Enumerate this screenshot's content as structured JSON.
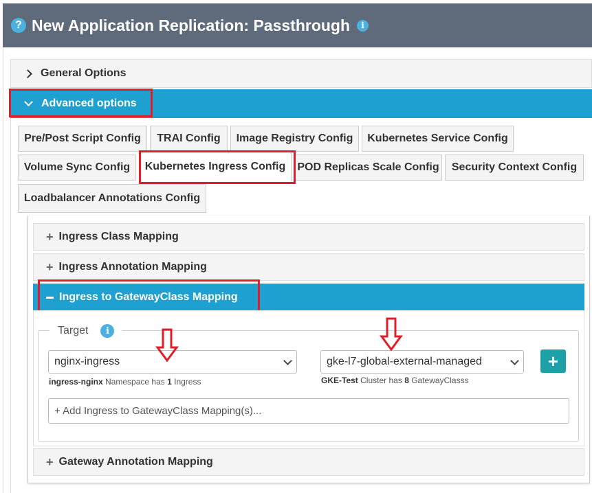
{
  "header": {
    "title": "New Application Replication: Passthrough",
    "help_glyph": "?",
    "info_glyph": "i"
  },
  "accordions": {
    "general": "General Options",
    "advanced": "Advanced options"
  },
  "tabs": [
    "Pre/Post Script Config",
    "TRAI Config",
    "Image Registry Config",
    "Kubernetes Service Config",
    "Volume Sync Config",
    "Kubernetes Ingress Config",
    "POD Replicas Scale Config",
    "Security Context Config",
    "Loadbalancer Annotations Config"
  ],
  "active_tab": "Kubernetes Ingress Config",
  "sub_accordions": {
    "ingress_class": "Ingress Class Mapping",
    "ingress_annotation": "Ingress Annotation Mapping",
    "ingress_gateway": "Ingress to GatewayClass Mapping",
    "gateway_annotation": "Gateway Annotation Mapping"
  },
  "target": {
    "legend": "Target",
    "info_glyph": "i",
    "ingress_select": "nginx-ingress",
    "ingress_hint_name": "ingress-nginx",
    "ingress_hint_text": "Namespace has",
    "ingress_hint_count": "1",
    "ingress_hint_unit": "Ingress",
    "gateway_select": "gke-l7-global-external-managed",
    "gateway_hint_name": "GKE-Test",
    "gateway_hint_text": "Cluster has",
    "gateway_hint_count": "8",
    "gateway_hint_unit": "GatewayClasss",
    "add_button": "+",
    "add_placeholder": "+ Add Ingress to GatewayClass Mapping(s)..."
  },
  "colors": {
    "header_bg": "#5f6b7a",
    "accent": "#1ea0d0",
    "highlight": "#e01e2a",
    "add_button": "#1ea0a8"
  },
  "icons": {
    "help": "question-circle-icon",
    "info": "info-circle-icon",
    "expand": "chevron-right-icon",
    "collapse": "chevron-down-icon",
    "plus": "plus-icon",
    "minus": "minus-icon",
    "annotation_arrow": "down-arrow-icon"
  }
}
